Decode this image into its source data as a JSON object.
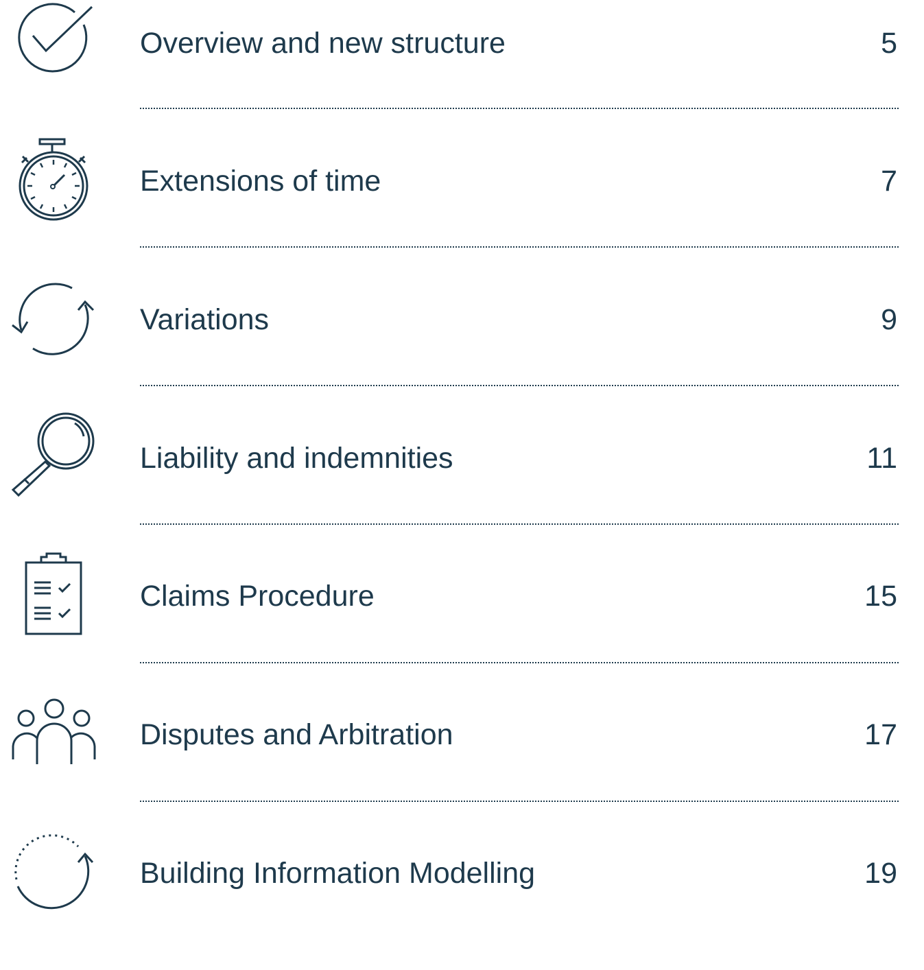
{
  "colors": {
    "text": "#1e3a4c",
    "icon_stroke": "#1e3a4c",
    "background": "#ffffff"
  },
  "toc": {
    "items": [
      {
        "title": "Overview and new structure",
        "page": "5",
        "icon": "checkmark-circle-icon"
      },
      {
        "title": "Extensions of time",
        "page": "7",
        "icon": "stopwatch-icon"
      },
      {
        "title": "Variations",
        "page": "9",
        "icon": "refresh-arrows-icon"
      },
      {
        "title": "Liability and indemnities",
        "page": "11",
        "icon": "magnifying-glass-icon"
      },
      {
        "title": "Claims Procedure",
        "page": "15",
        "icon": "clipboard-checklist-icon"
      },
      {
        "title": "Disputes and Arbitration",
        "page": "17",
        "icon": "people-group-icon"
      },
      {
        "title": "Building Information Modelling",
        "page": "19",
        "icon": "dotted-cycle-icon"
      }
    ]
  }
}
